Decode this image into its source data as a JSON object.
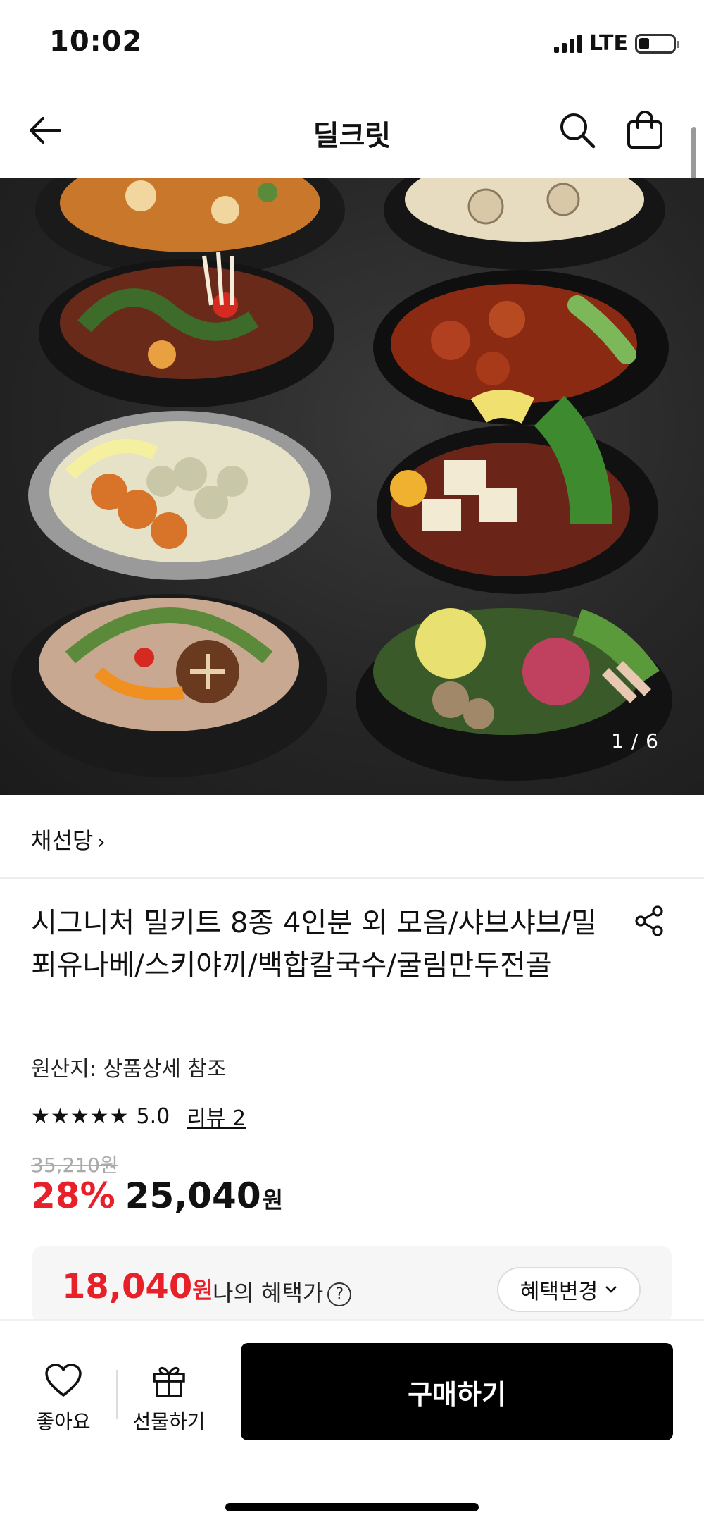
{
  "status": {
    "time": "10:02",
    "network": "LTE"
  },
  "nav": {
    "title": "딜크릿"
  },
  "gallery": {
    "counter": "1 / 6"
  },
  "product": {
    "seller": "채선당",
    "title": "시그니처 밀키트 8종 4인분 외 모음/샤브샤브/밀푀유나베/스키야끼/백합칼국수/굴림만두전골",
    "origin": "원산지: 상품상세 참조",
    "rating_stars": "★★★★★",
    "rating": "5.0",
    "review_link": "리뷰 2",
    "original_price": "35,210원",
    "discount": "28%",
    "price": "25,040",
    "currency": "원"
  },
  "benefit": {
    "price": "18,040",
    "currency": "원",
    "label": "나의 혜택가",
    "help_symbol": "?",
    "change_button": "혜택변경",
    "chevron": "⌄"
  },
  "bottom_bar": {
    "like_label": "좋아요",
    "gift_label": "선물하기",
    "buy_label": "구매하기"
  },
  "colors": {
    "accent_red": "#e8202a",
    "buy_button": "#000000"
  },
  "icons": [
    "back-arrow-icon",
    "search-icon",
    "shopping-bag-icon",
    "share-icon",
    "help-icon",
    "heart-icon",
    "gift-icon"
  ]
}
